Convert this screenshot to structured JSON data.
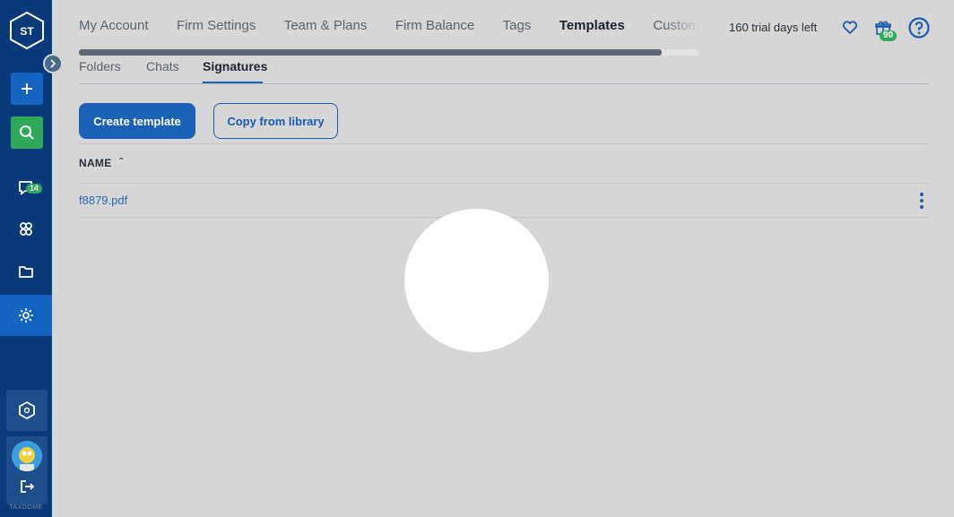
{
  "sidebar": {
    "logo_text": "ST",
    "messages_badge": "14",
    "brand_footer": "TAXDOME"
  },
  "topnav": {
    "tabs": [
      {
        "label": "My Account",
        "active": false
      },
      {
        "label": "Firm Settings",
        "active": false
      },
      {
        "label": "Team & Plans",
        "active": false
      },
      {
        "label": "Firm Balance",
        "active": false
      },
      {
        "label": "Tags",
        "active": false
      },
      {
        "label": "Templates",
        "active": true
      },
      {
        "label": "Custom",
        "active": false
      }
    ],
    "progress_fraction": 0.94,
    "trial_text": "160 trial days left",
    "gift_badge": "90"
  },
  "subtabs": [
    {
      "label": "Folders",
      "active": false
    },
    {
      "label": "Chats",
      "active": false
    },
    {
      "label": "Signatures",
      "active": true
    }
  ],
  "actions": {
    "create_label": "Create template",
    "copy_label": "Copy from library"
  },
  "table": {
    "column_name": "NAME",
    "rows": [
      {
        "name": "f8879.pdf"
      }
    ]
  },
  "colors": {
    "sidebar_bg": "#0b3a7a",
    "primary": "#1b62b7",
    "success": "#2fa85a",
    "page_bg": "#d6d6d6"
  }
}
